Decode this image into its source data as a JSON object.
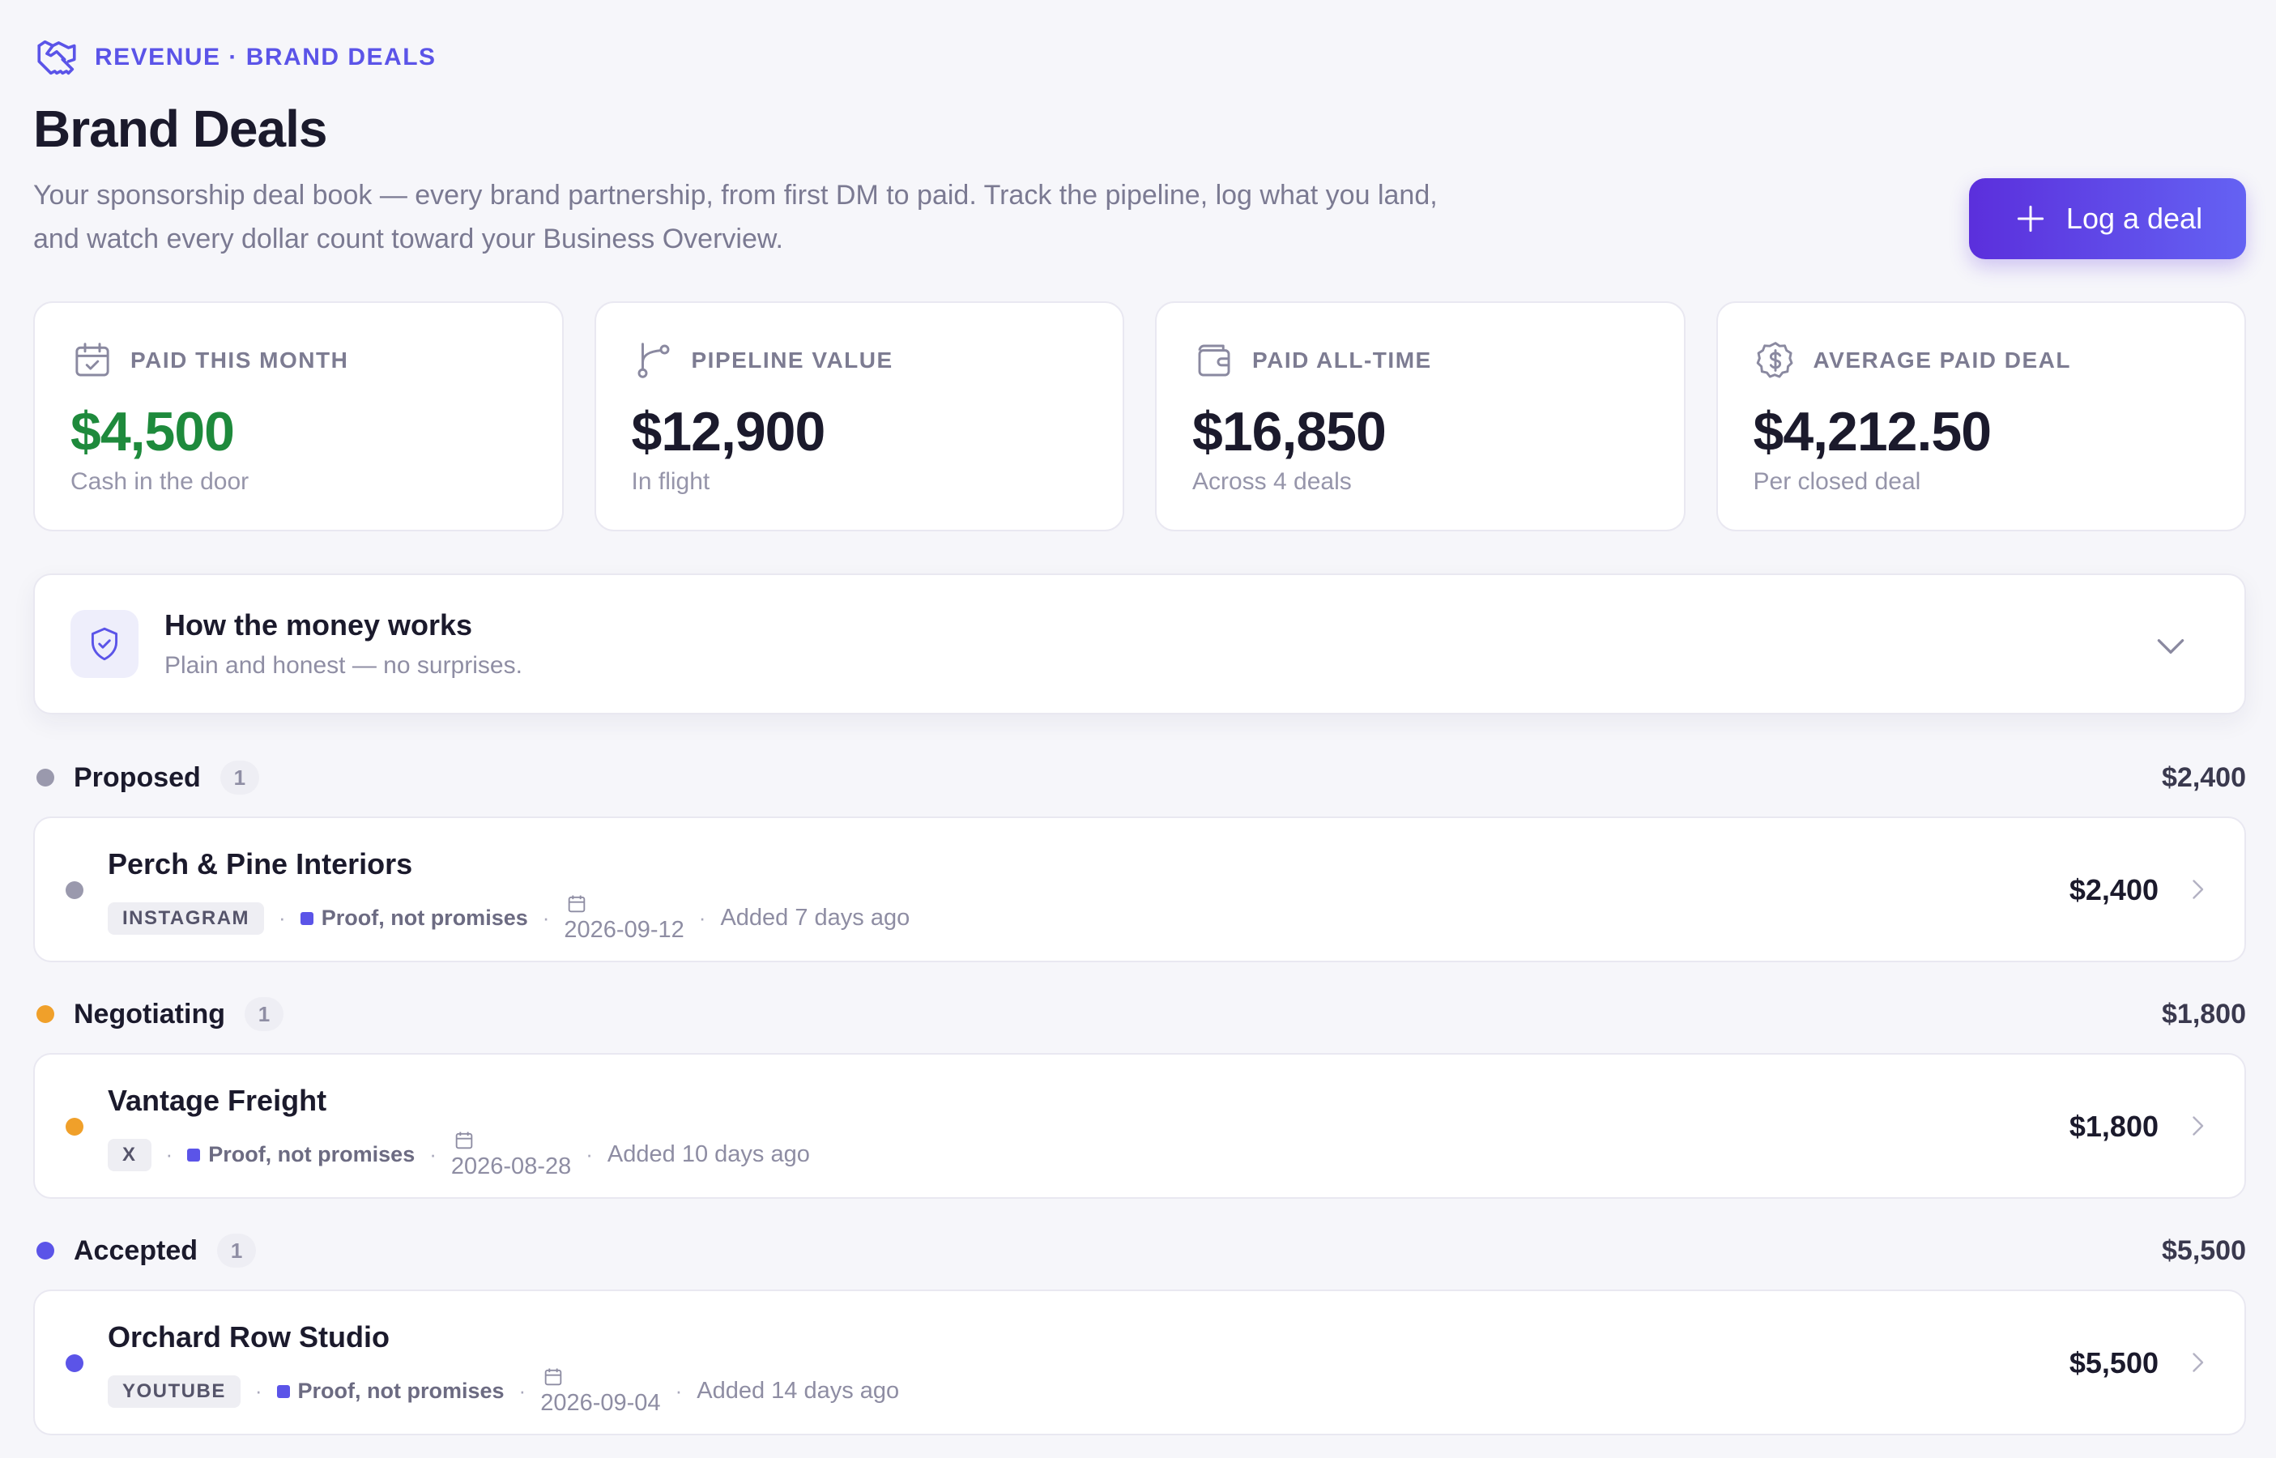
{
  "header": {
    "breadcrumb": "REVENUE · BRAND DEALS",
    "title": "Brand Deals",
    "subtitle": "Your sponsorship deal book — every brand partnership, from first DM to paid. Track the pipeline, log what you land, and watch every dollar count toward your Business Overview.",
    "log_button": "Log a deal"
  },
  "stats": [
    {
      "label": "PAID THIS MONTH",
      "value": "$4,500",
      "note": "Cash in the door",
      "icon": "calendar-check-icon"
    },
    {
      "label": "PIPELINE VALUE",
      "value": "$12,900",
      "note": "In flight",
      "icon": "git-branch-icon"
    },
    {
      "label": "PAID ALL-TIME",
      "value": "$16,850",
      "note": "Across 4 deals",
      "icon": "wallet-icon"
    },
    {
      "label": "AVERAGE PAID DEAL",
      "value": "$4,212.50",
      "note": "Per closed deal",
      "icon": "dollar-badge-icon"
    }
  ],
  "info": {
    "title": "How the money works",
    "subtitle": "Plain and honest — no surprises."
  },
  "colors": {
    "accent": "#5b54e8",
    "paid_green": "#1e8a3c",
    "proposed": "#9a99ad",
    "negotiating": "#f0a02a",
    "accepted": "#5b54e8"
  },
  "groups": [
    {
      "name": "Proposed",
      "count": "1",
      "total": "$2,400",
      "deals": [
        {
          "name": "Perch & Pine Interiors",
          "platform": "INSTAGRAM",
          "note": "Proof, not promises",
          "date": "2026-09-12",
          "added": "Added 7 days ago",
          "amount": "$2,400"
        }
      ]
    },
    {
      "name": "Negotiating",
      "count": "1",
      "total": "$1,800",
      "deals": [
        {
          "name": "Vantage Freight",
          "platform": "X",
          "note": "Proof, not promises",
          "date": "2026-08-28",
          "added": "Added 10 days ago",
          "amount": "$1,800"
        }
      ]
    },
    {
      "name": "Accepted",
      "count": "1",
      "total": "$5,500",
      "deals": [
        {
          "name": "Orchard Row Studio",
          "platform": "YOUTUBE",
          "note": "Proof, not promises",
          "date": "2026-09-04",
          "added": "Added 14 days ago",
          "amount": "$5,500"
        }
      ]
    }
  ]
}
